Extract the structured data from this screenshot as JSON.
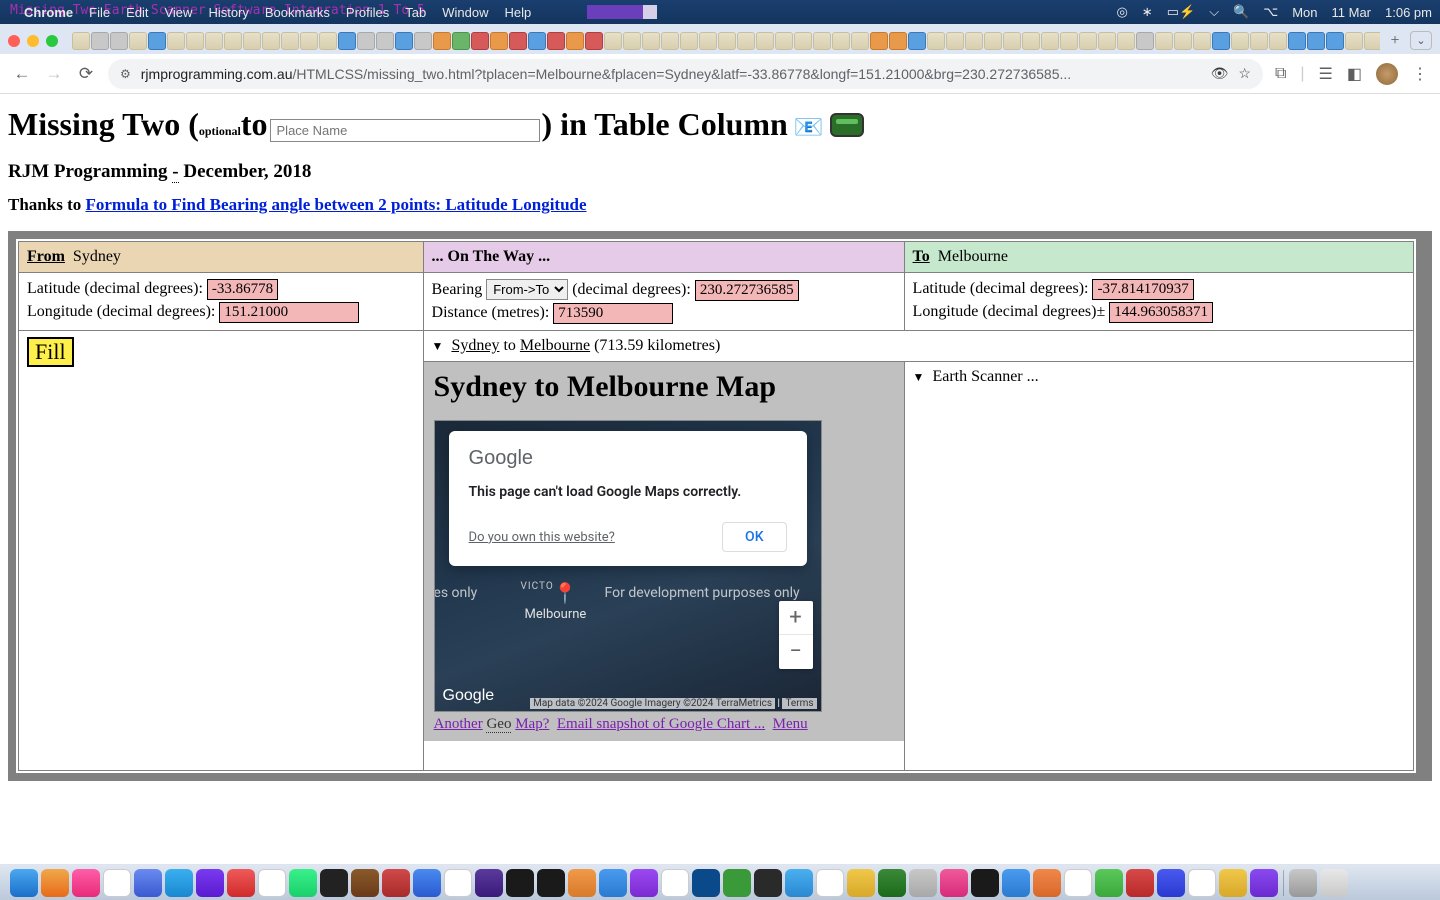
{
  "os": {
    "ghost_title": "Missing Two Earth Scanner Software Integration   1 To 5",
    "menus": {
      "apple": "",
      "app": "Chrome",
      "items": [
        "File",
        "Edit",
        "View",
        "History",
        "Bookmarks",
        "Profiles",
        "Tab",
        "Window",
        "Help"
      ]
    },
    "status": {
      "day": "Mon",
      "date": "11 Mar",
      "time": "1:06 pm"
    }
  },
  "browser": {
    "url_host": "rjmprogramming.com.au",
    "url_path": "/HTMLCSS/missing_two.html?tplacen=Melbourne&fplacen=Sydney&latf=-33.86778&longf=151.21000&brg=230.272736585...",
    "tab_plus": "+"
  },
  "page": {
    "h1_a": "Missing Two (",
    "h1_opt": "optional",
    "h1_to": " to ",
    "h1_b": ") in Table Column ",
    "place_placeholder": "Place Name",
    "sub1_a": "RJM Programming ",
    "sub1_dash": "-",
    "sub1_b": " December, 2018",
    "sub2_a": "Thanks to ",
    "sub2_link": "Formula to Find Bearing angle between 2 points: Latitude Longitude"
  },
  "cols": {
    "from": {
      "label": "From",
      "place": "Sydney"
    },
    "mid": {
      "label": "... On The Way ..."
    },
    "to": {
      "label": "To",
      "place": "Melbourne"
    }
  },
  "from": {
    "lat_label": "Latitude (decimal degrees): ",
    "lat_value": "-33.86778",
    "lon_label": "Longitude (decimal degrees): ",
    "lon_value": "151.21000"
  },
  "mid": {
    "bearing_label": "Bearing ",
    "dir_select": "From->To",
    "bearing_suffix": " (decimal degrees): ",
    "bearing_value": "230.272736585",
    "dist_label": "Distance (metres): ",
    "dist_value": "713590"
  },
  "to": {
    "lat_label": "Latitude (decimal degrees): ",
    "lat_value": "-37.814170937",
    "lon_label": "Longitude (decimal degrees)",
    "lon_pm": "±",
    "lon_value": "144.963058371"
  },
  "fill_btn": "Fill",
  "summary": {
    "tri": "▼",
    "from": "Sydney",
    "to_word": "to",
    "to": "Melbourne",
    "dist": "(713.59 kilometres)"
  },
  "map": {
    "title": "Sydney to Melbourne Map",
    "google": "Google",
    "err_msg": "This page can't load Google Maps correctly.",
    "own": "Do you own this website?",
    "ok": "OK",
    "dev_wm": "For development purposes only",
    "dev_wm_l": "oment purposes only",
    "victo": "VICTO",
    "melb": "Melbourne",
    "attrib": "Map data ©2024 Google Imagery ©2024 TerraMetrics",
    "terms": "Terms",
    "plus": "+",
    "minus": "−",
    "links": {
      "another": "Another",
      "geo": "Geo",
      "mapq": "Map?",
      "email": "Email snapshot of Google Chart ...",
      "menu": "Menu"
    }
  },
  "earth": {
    "tri": "▼",
    "label": "Earth Scanner ..."
  }
}
